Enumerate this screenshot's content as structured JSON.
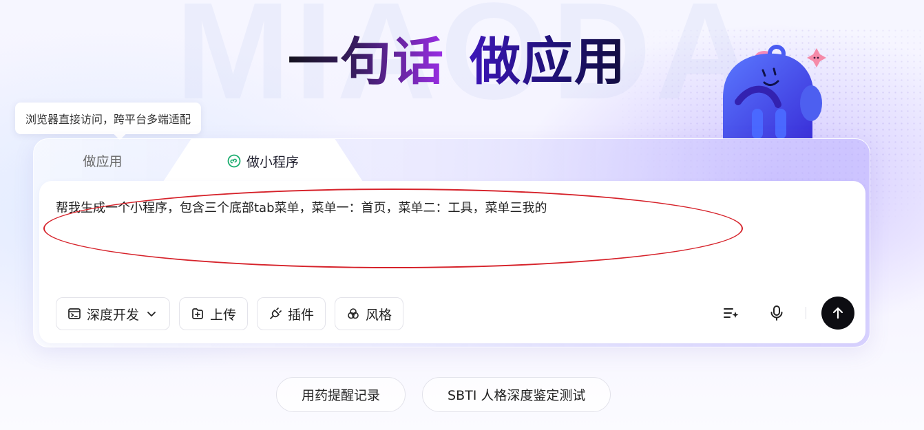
{
  "background": {
    "watermark": "MIAODA"
  },
  "headline": {
    "part1": "一句话",
    "part2": "做应用"
  },
  "tooltip": {
    "text": "浏览器直接访问，跨平台多端适配"
  },
  "tabs": [
    {
      "label": "做应用",
      "active": false
    },
    {
      "label": "做小程序",
      "active": true,
      "icon": "miniprogram-icon"
    }
  ],
  "input": {
    "value": "帮我生成一个小程序，包含三个底部tab菜单，菜单一：首页，菜单二：工具，菜单三我的",
    "annotation_color": "#d6222a"
  },
  "toolbar": {
    "mode_label": "深度开发",
    "upload_label": "上传",
    "plugin_label": "插件",
    "style_label": "风格"
  },
  "suggestions": [
    "用药提醒记录",
    "SBTI 人格深度鉴定测试"
  ],
  "colors": {
    "accent": "#3d16b8",
    "send_button": "#0d0d12",
    "miniprogram_icon": "#1aad6e"
  }
}
